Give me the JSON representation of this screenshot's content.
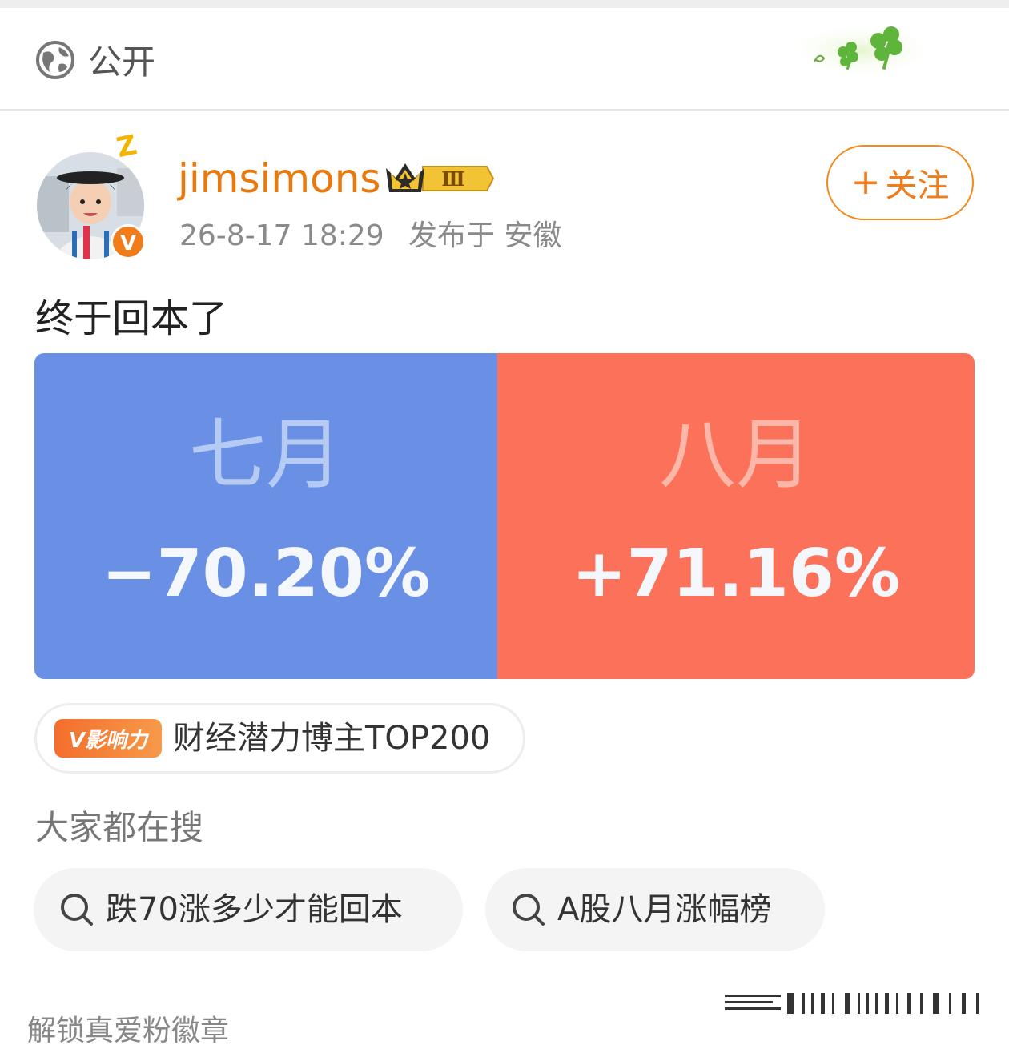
{
  "visibility": {
    "label": "公开",
    "icon": "globe-icon"
  },
  "post": {
    "author": {
      "name": "jimsimons",
      "rank_badge": "Ⅲ",
      "verified_icon": "v-verified-icon"
    },
    "time": "26-8-17 18:29",
    "location": "发布于 安徽",
    "follow_label": "关注",
    "text": "终于回本了",
    "image": {
      "left": {
        "month": "七月",
        "pct": "−70.20%",
        "color": "#6a90e6"
      },
      "right": {
        "month": "八月",
        "pct": "+71.16%",
        "color": "#fb715a"
      }
    },
    "influence": {
      "tag": "V影响力",
      "text": "财经潜力博主TOP200"
    }
  },
  "search": {
    "heading": "大家都在搜",
    "chips": [
      {
        "text": "跌70涨多少才能回本"
      },
      {
        "text": "A股八月涨幅榜"
      }
    ]
  },
  "footer": {
    "cut_text": "解锁真爱粉徽章"
  }
}
